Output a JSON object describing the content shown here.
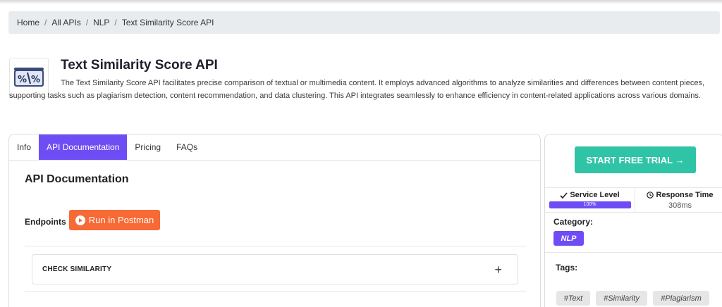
{
  "breadcrumb": {
    "items": [
      "Home",
      "All APIs",
      "NLP",
      "Text Similarity Score API"
    ]
  },
  "api": {
    "title": "Text Similarity Score API",
    "description": "The Text Similarity Score API facilitates precise comparison of textual or multimedia content. It employs advanced algorithms to analyze similarities and differences between content pieces, supporting tasks such as plagiarism detection, content recommendation, and data clustering. This API integrates seamlessly to enhance efficiency in content-related applications across various domains.",
    "logo_icon": "percent-compare-icon"
  },
  "tabs": [
    "Info",
    "API Documentation",
    "Pricing",
    "FAQs"
  ],
  "active_tab": "API Documentation",
  "documentation": {
    "heading": "API Documentation",
    "endpoints_label": "Endpoints",
    "postman_button": "Run in Postman",
    "endpoint_name": "CHECK SIMILARITY",
    "expand_symbol": "+"
  },
  "sidebar": {
    "trial_button": "START FREE TRIAL →",
    "service_level": {
      "label": "Service Level",
      "value": "100%",
      "percent": 100
    },
    "response_time": {
      "label": "Response Time",
      "value": "308ms"
    },
    "category_label": "Category:",
    "category": "NLP",
    "tags_label": "Tags:",
    "tags": [
      "#Text",
      "#Similarity",
      "#Plagiarism"
    ]
  },
  "colors": {
    "accent": "#6f4df5",
    "postman": "#f76935",
    "trial": "#2ec4a5",
    "breadcrumb_bg": "#e9ecef"
  }
}
